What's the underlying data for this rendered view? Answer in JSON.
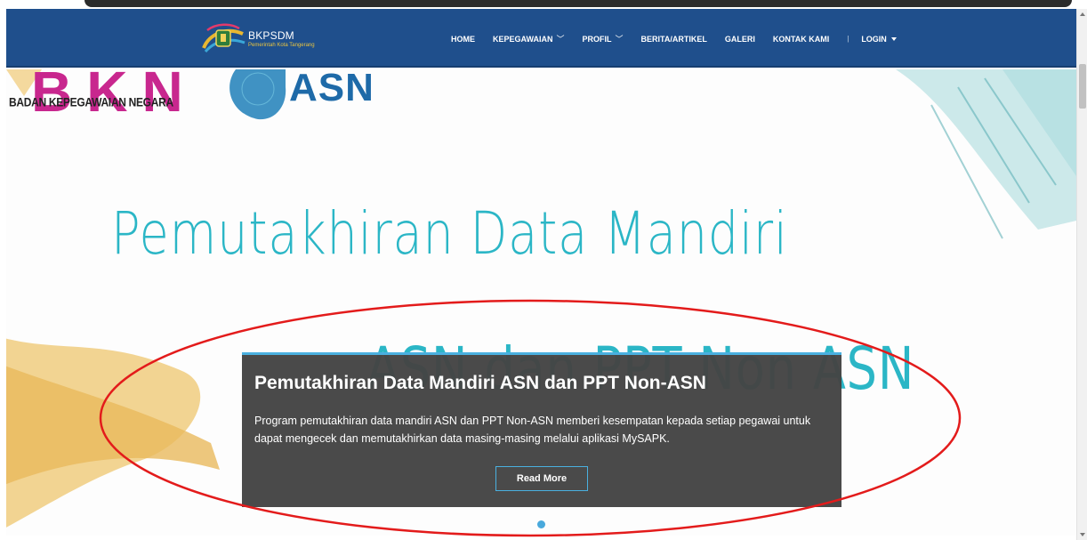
{
  "navbar": {
    "brand_name": "BKPSDM",
    "brand_sub": "Pemerintah Kota Tangerang",
    "items": [
      {
        "label": "HOME",
        "has_dropdown": false
      },
      {
        "label": "KEPEGAWAIAN",
        "has_dropdown": true
      },
      {
        "label": "PROFIL",
        "has_dropdown": true
      },
      {
        "label": "BERITA/ARTIKEL",
        "has_dropdown": false
      },
      {
        "label": "GALERI",
        "has_dropdown": false
      },
      {
        "label": "KONTAK KAMI",
        "has_dropdown": false
      }
    ],
    "separator": "|",
    "login_label": "LOGIN"
  },
  "hero": {
    "bkn_logo": "BKN",
    "bkn_caption": "BADAN KEPEGAWAIAN NEGARA",
    "asn_logo": "ASN",
    "heading": "Pemutakhiran Data Mandiri",
    "subheading": "ASN dan PPT Non ASN"
  },
  "slide": {
    "title": "Pemutakhiran Data Mandiri ASN dan PPT Non-ASN",
    "text": "Program pemutakhiran data mandiri ASN dan PPT Non-ASN memberi kesempatan kepada setiap pegawai untuk dapat mengecek dan memutakhirkan data masing-masing melalui aplikasi MySAPK.",
    "button_label": "Read More"
  },
  "colors": {
    "navbar": "#1f4f8c",
    "accent": "#4ab0e0",
    "heading": "#2bb6c6",
    "caption_bg": "#444444",
    "annotation": "#e31b1b"
  }
}
